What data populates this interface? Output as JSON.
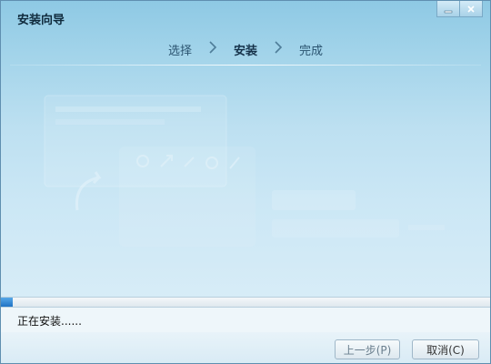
{
  "window": {
    "title": "安装向导"
  },
  "controls": {
    "minimize_icon": "minimize-icon",
    "close_icon": "close-icon"
  },
  "steps": [
    {
      "label": "选择",
      "state": "done"
    },
    {
      "label": "安装",
      "state": "active"
    },
    {
      "label": "完成",
      "state": "pending"
    }
  ],
  "progress": {
    "fraction": 0.025,
    "status_text": "正在安装......"
  },
  "buttons": {
    "prev_label": "上一步(P)",
    "cancel_label": "取消(C)"
  },
  "colors": {
    "accent": "#2f8ad8",
    "header_top": "#8ec9e4",
    "header_bottom": "#d7ecf7"
  }
}
